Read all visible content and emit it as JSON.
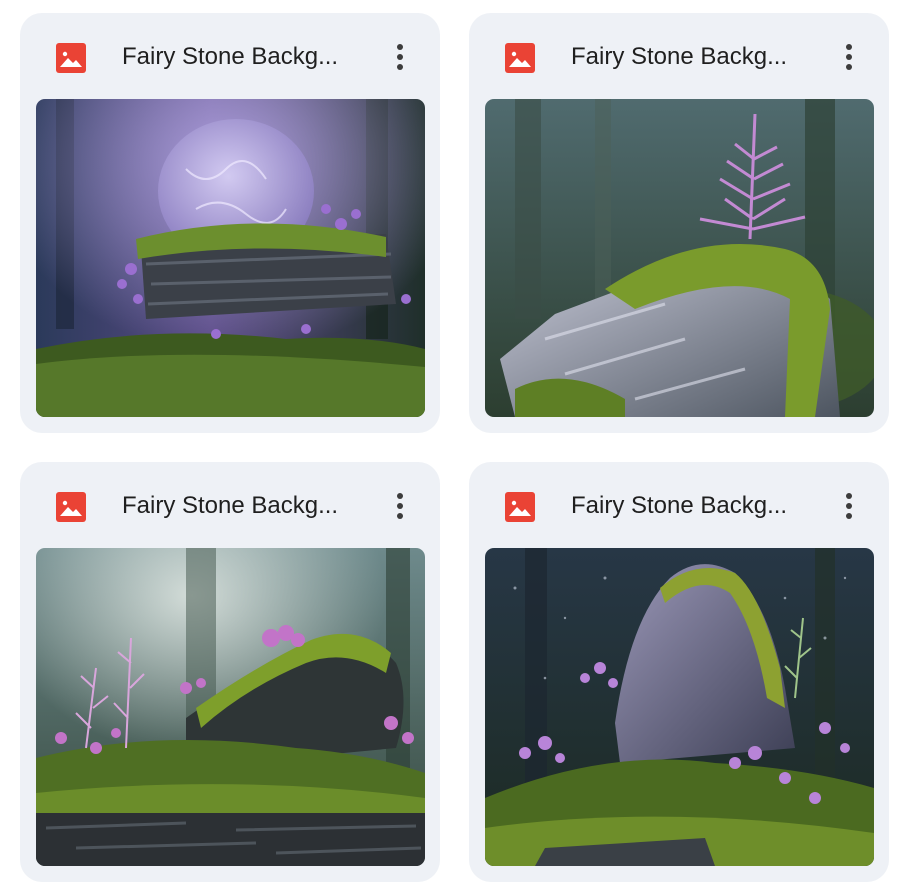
{
  "files": [
    {
      "name": "Fairy Stone Backg...",
      "icon": "image-file-icon",
      "thumbnail": "mossy-stone-with-crystal-orb"
    },
    {
      "name": "Fairy Stone Backg...",
      "icon": "image-file-icon",
      "thumbnail": "mossy-rock-with-fern"
    },
    {
      "name": "Fairy Stone Backg...",
      "icon": "image-file-icon",
      "thumbnail": "moss-covered-ledge-with-ferns"
    },
    {
      "name": "Fairy Stone Backg...",
      "icon": "image-file-icon",
      "thumbnail": "standing-stone-with-flowers"
    }
  ],
  "colors": {
    "card_background": "#eef1f6",
    "image_icon_red": "#ea4335",
    "title_text": "#1f1f1f"
  }
}
